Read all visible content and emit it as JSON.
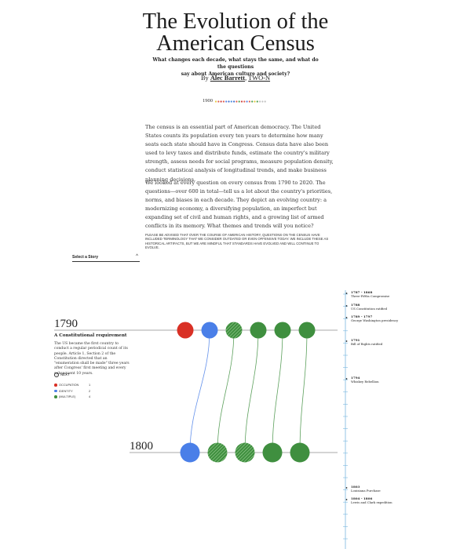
{
  "header": {
    "title_line1": "The Evolution of the",
    "title_line2": "American Census",
    "subtitle_line1": "What changes each decade, what stays the same, and what do the questions",
    "subtitle_line2": "say about American culture and society?",
    "by": "By",
    "author": "Alec Barrett",
    "org": "TWO-N"
  },
  "timeline_strip": {
    "year": "1900",
    "dots": [
      "#e8c840",
      "#e06050",
      "#d04040",
      "#e06050",
      "#6080e0",
      "#4070d0",
      "#5090e0",
      "#4070d0",
      "#e06050",
      "#50a050",
      "#d04040",
      "#e06050",
      "#6080e0",
      "#e06050",
      "#50a050",
      "#e8c840",
      "#50a050",
      "#c0c0c0",
      "#c0c0c0",
      "#c0c0c0"
    ]
  },
  "intro": {
    "p1": "The census is an essential part of American democracy. The United States counts its population every ten years to determine how many seats each state should have in Congress. Census data have also been used to levy taxes and distribute funds, estimate the country's military strength, assess needs for social programs, measure population density, conduct statistical analysis of longitudinal trends, and make business planning decisions.",
    "p2": "We looked at every question on every census from 1790 to 2020. The questions—over 600 in total—tell us a lot about the country's priorities, norms, and biases in each decade. They depict an evolving country: a modernizing economy, a diversifying population, an imperfect but expanding set of civil and human rights, and a growing list of armed conflicts in its memory. What themes and trends will you notice?",
    "note": "Please be advised that over the course of American history, questions on the census have included terminology that we consider outdated or even offensive today. We include these as historical artifacts, but we are mindful that standards have evolved and will continue to evolve."
  },
  "story_select": {
    "label": "Select a Story",
    "caret": "^"
  },
  "years": {
    "first": "1790",
    "second": "1800"
  },
  "panel": {
    "heading": "A Constitutional requirement",
    "text": "The US became the first country to conduct a regular periodical count of its people. Article 1, Section 2 of the Constitution directed that an \"enumeration shall be made\" three years after Congress' first meeting and every subsequent 10 years.",
    "next_label": "NEXT",
    "next_icon": "arrow-down-icon"
  },
  "legend": [
    {
      "label": "OCCUPATION",
      "count": "1",
      "color": "#d93025"
    },
    {
      "label": "IDENTITY",
      "count": "2",
      "color": "#4a7fe8"
    },
    {
      "label": "(MULTIPLE)",
      "count": "4",
      "color": "#3f8f3f"
    }
  ],
  "colors": {
    "occupation": "#d93025",
    "identity": "#4a7fe8",
    "multiple": "#3f8f3f",
    "timeline_axis": "#7ab8e0"
  },
  "questions_1790": [
    {
      "category": "occupation",
      "hatched": false
    },
    {
      "category": "identity",
      "hatched": false
    },
    {
      "category": "multiple",
      "hatched": true
    },
    {
      "category": "multiple",
      "hatched": false
    },
    {
      "category": "multiple",
      "hatched": false
    },
    {
      "category": "multiple",
      "hatched": false
    }
  ],
  "questions_1800": [
    {
      "category": "identity",
      "hatched": false
    },
    {
      "category": "multiple",
      "hatched": true
    },
    {
      "category": "multiple",
      "hatched": true
    },
    {
      "category": "multiple",
      "hatched": false
    },
    {
      "category": "multiple",
      "hatched": false
    }
  ],
  "links": [
    [
      1,
      0
    ],
    [
      2,
      1
    ],
    [
      3,
      2
    ],
    [
      4,
      3
    ],
    [
      5,
      4
    ]
  ],
  "timeline_events": [
    {
      "year": "1787 - 1868",
      "text": "Three-Fifths Compromise"
    },
    {
      "year": "1788",
      "text": "US Constitution ratified"
    },
    {
      "year": "1789 - 1797",
      "text": "George Washington presidency"
    },
    {
      "year": "1791",
      "text": "Bill of Rights ratified"
    },
    {
      "year": "1794",
      "text": "Whiskey Rebellion"
    },
    {
      "year": "1803",
      "text": "Louisiana Purchase"
    },
    {
      "year": "1804 - 1806",
      "text": "Lewis and Clark expedition"
    }
  ]
}
